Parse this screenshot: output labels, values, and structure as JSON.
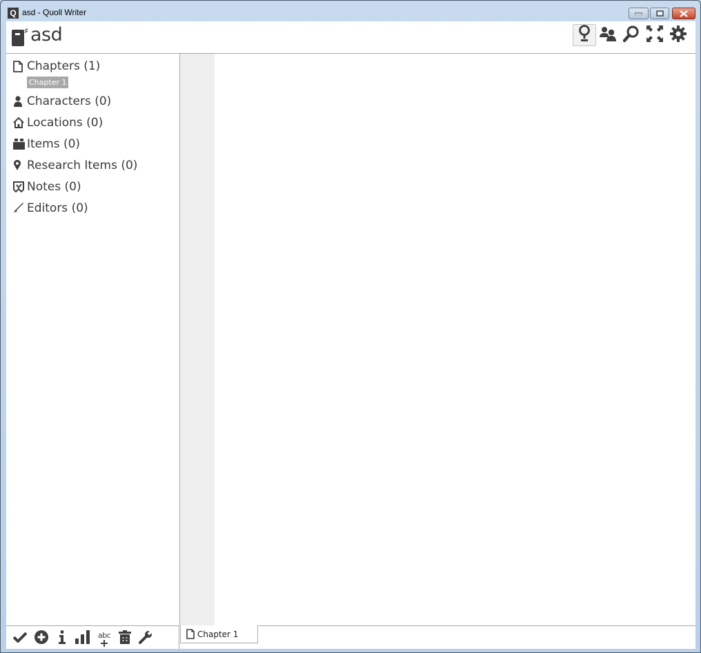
{
  "window": {
    "title": "asd - Quoll Writer",
    "app_icon_letter": "Q",
    "controls": [
      "minimize",
      "maximize",
      "close"
    ]
  },
  "header": {
    "project_title": "asd",
    "project_icon": "book-icon",
    "toolbar": [
      {
        "name": "idea-board",
        "icon": "lightbulb-icon",
        "active": true
      },
      {
        "name": "contacts",
        "icon": "people-icon",
        "active": false
      },
      {
        "name": "find",
        "icon": "search-icon",
        "active": false
      },
      {
        "name": "full-screen",
        "icon": "fullscreen-icon",
        "active": false
      },
      {
        "name": "settings",
        "icon": "gear-icon",
        "active": false
      }
    ]
  },
  "sidebar": {
    "items": [
      {
        "label": "Chapters (1)",
        "icon": "document-icon",
        "children": [
          "Chapter 1"
        ]
      },
      {
        "label": "Characters (0)",
        "icon": "person-icon"
      },
      {
        "label": "Locations (0)",
        "icon": "house-icon"
      },
      {
        "label": "Items (0)",
        "icon": "box-icon"
      },
      {
        "label": "Research Items (0)",
        "icon": "pin-icon"
      },
      {
        "label": "Notes (0)",
        "icon": "note-icon"
      },
      {
        "label": "Editors (0)",
        "icon": "pen-icon"
      }
    ],
    "footer_buttons": [
      {
        "name": "problem-finder",
        "icon": "check-icon"
      },
      {
        "name": "add",
        "icon": "plus-circle-icon"
      },
      {
        "name": "info",
        "icon": "info-icon"
      },
      {
        "name": "statistics",
        "icon": "bar-chart-icon"
      },
      {
        "name": "spelling",
        "icon": "abc-plus-icon",
        "text": "abc"
      },
      {
        "name": "trash",
        "icon": "trash-icon"
      },
      {
        "name": "tools",
        "icon": "wrench-icon"
      }
    ]
  },
  "tabs": [
    {
      "label": "Chapter 1",
      "icon": "document-icon",
      "active": true
    }
  ]
}
